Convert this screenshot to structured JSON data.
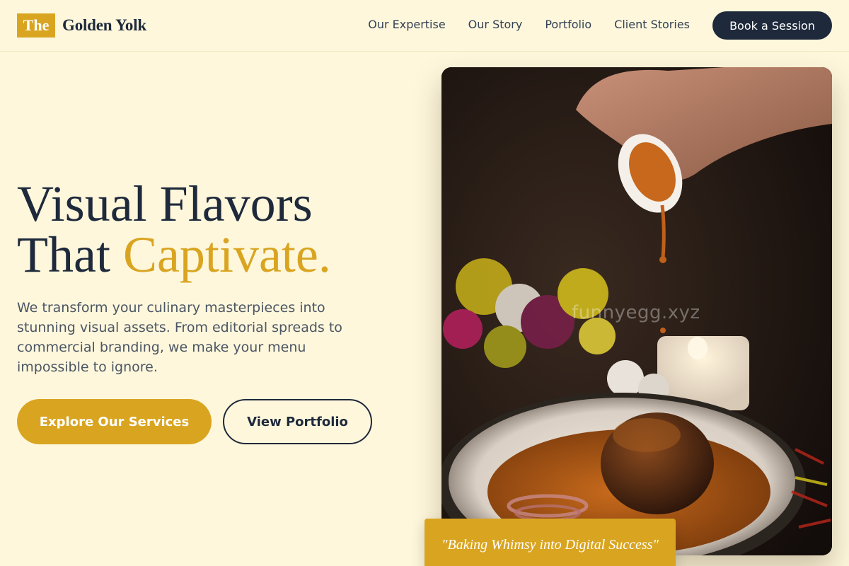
{
  "header": {
    "logo_badge": "The",
    "logo_name": "Golden Yolk",
    "nav": [
      "Our Expertise",
      "Our Story",
      "Portfolio",
      "Client Stories"
    ],
    "cta_label": "Book a Session"
  },
  "hero": {
    "title_line1": "Visual Flavors",
    "title_line2_plain": "That ",
    "title_line2_accent": "Captivate.",
    "description": "We transform your culinary masterpieces into stunning visual assets. From editorial spreads to commercial branding, we make your menu impossible to ignore.",
    "primary_button": "Explore Our Services",
    "secondary_button": "View Portfolio",
    "image_watermark": "funnyegg.xyz",
    "tagline": "\"Baking Whimsy into Digital Success\""
  },
  "colors": {
    "background": "#fef7dc",
    "accent": "#d9a521",
    "dark": "#1e293b",
    "body_text": "#4b5563"
  },
  "icons": {
    "hero_image": "food-photo-plate-sauce-pour"
  }
}
